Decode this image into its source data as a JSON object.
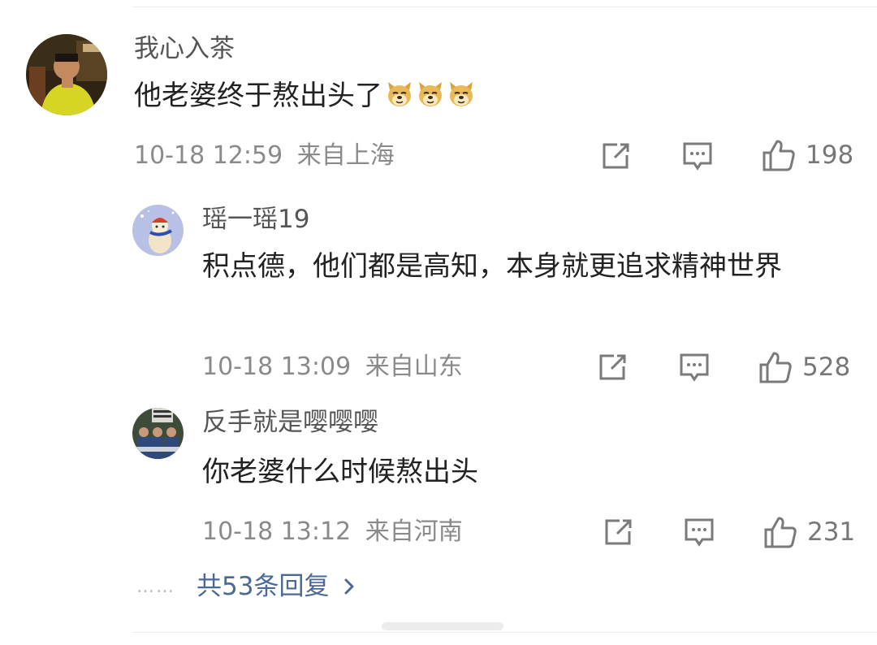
{
  "comment": {
    "username": "我心入茶",
    "text": "他老婆终于熬出头了",
    "emojis": [
      "doge-emoji",
      "doge-emoji",
      "doge-emoji"
    ],
    "time": "10-18 12:59",
    "location": "来自上海",
    "likes": "198"
  },
  "replies": [
    {
      "username": "瑶一瑶19",
      "text": "积点德，他们都是高知，本身就更追求精神世界",
      "time": "10-18 13:09",
      "location": "来自山东",
      "likes": "528"
    },
    {
      "username": "反手就是嘤嘤嘤",
      "text": "你老婆什么时候熬出头",
      "time": "10-18 13:12",
      "location": "来自河南",
      "likes": "231"
    }
  ],
  "more_replies": {
    "dots": "……",
    "label": "共53条回复"
  },
  "colors": {
    "link": "#4a6a95",
    "meta": "#8a8a8a",
    "icon": "#7a7a7a"
  }
}
